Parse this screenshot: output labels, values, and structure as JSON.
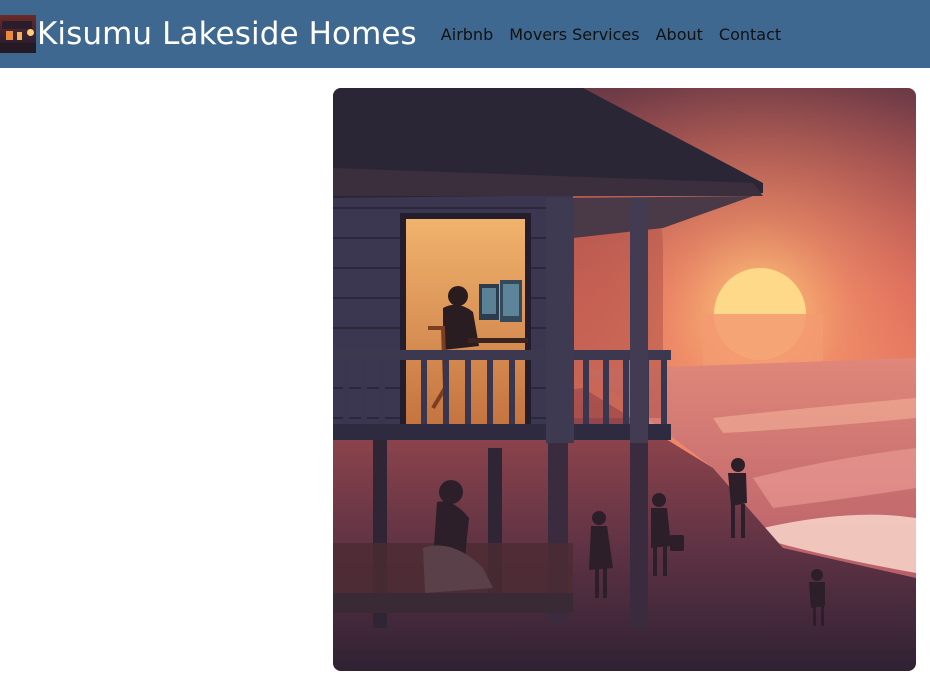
{
  "navbar": {
    "brand": {
      "title": "Kisumu Lakeside Homes",
      "logo_icon": "lakeside-house-logo-icon"
    },
    "links": [
      {
        "label": "Airbnb"
      },
      {
        "label": "Movers Services"
      },
      {
        "label": "About"
      },
      {
        "label": "Contact"
      }
    ],
    "background_color": "#3f6890"
  },
  "main": {
    "hero_image": {
      "subject": "sunset-beach-house-illustration"
    }
  }
}
